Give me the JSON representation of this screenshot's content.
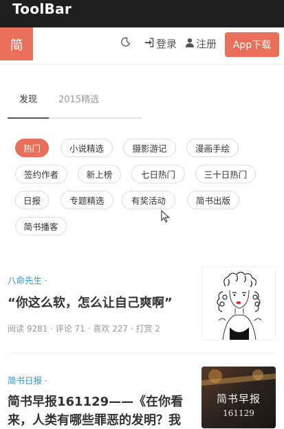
{
  "toolbar": {
    "title": "ToolBar"
  },
  "navbar": {
    "logo": "简",
    "login": "登录",
    "register": "注册",
    "app_button": "App下载",
    "icons": [
      "moon-icon",
      "sign-in-icon",
      "user-icon"
    ]
  },
  "tabs": [
    {
      "label": "发现",
      "active": true
    },
    {
      "label": "2015精选",
      "active": false
    }
  ],
  "tags": [
    {
      "label": "热门",
      "active": true
    },
    {
      "label": "小说精选",
      "active": false
    },
    {
      "label": "摄影游记",
      "active": false
    },
    {
      "label": "漫画手绘",
      "active": false
    },
    {
      "label": "签约作者",
      "active": false
    },
    {
      "label": "新上榜",
      "active": false
    },
    {
      "label": "七日热门",
      "active": false
    },
    {
      "label": "三十日热门",
      "active": false
    },
    {
      "label": "日报",
      "active": false
    },
    {
      "label": "专题精选",
      "active": false
    },
    {
      "label": "有奖活动",
      "active": false
    },
    {
      "label": "简书出版",
      "active": false
    },
    {
      "label": "简书播客",
      "active": false
    }
  ],
  "articles": [
    {
      "author": "八命先生 ·",
      "title": "“你这么软，怎么让自己爽啊”",
      "meta": "阅读 9281 · 评论 71 · 喜欢 227 · 打赏 2"
    },
    {
      "author": "简书日报 ·",
      "title": "简书早报161129——《在你看来，人类有哪些罪恶的发明？我",
      "thumb_text_1": "简书早报",
      "thumb_text_2": "161129"
    }
  ],
  "colors": {
    "accent": "#ea6f5a",
    "link": "#3194d0",
    "toolbar": "#1f1f1f"
  }
}
